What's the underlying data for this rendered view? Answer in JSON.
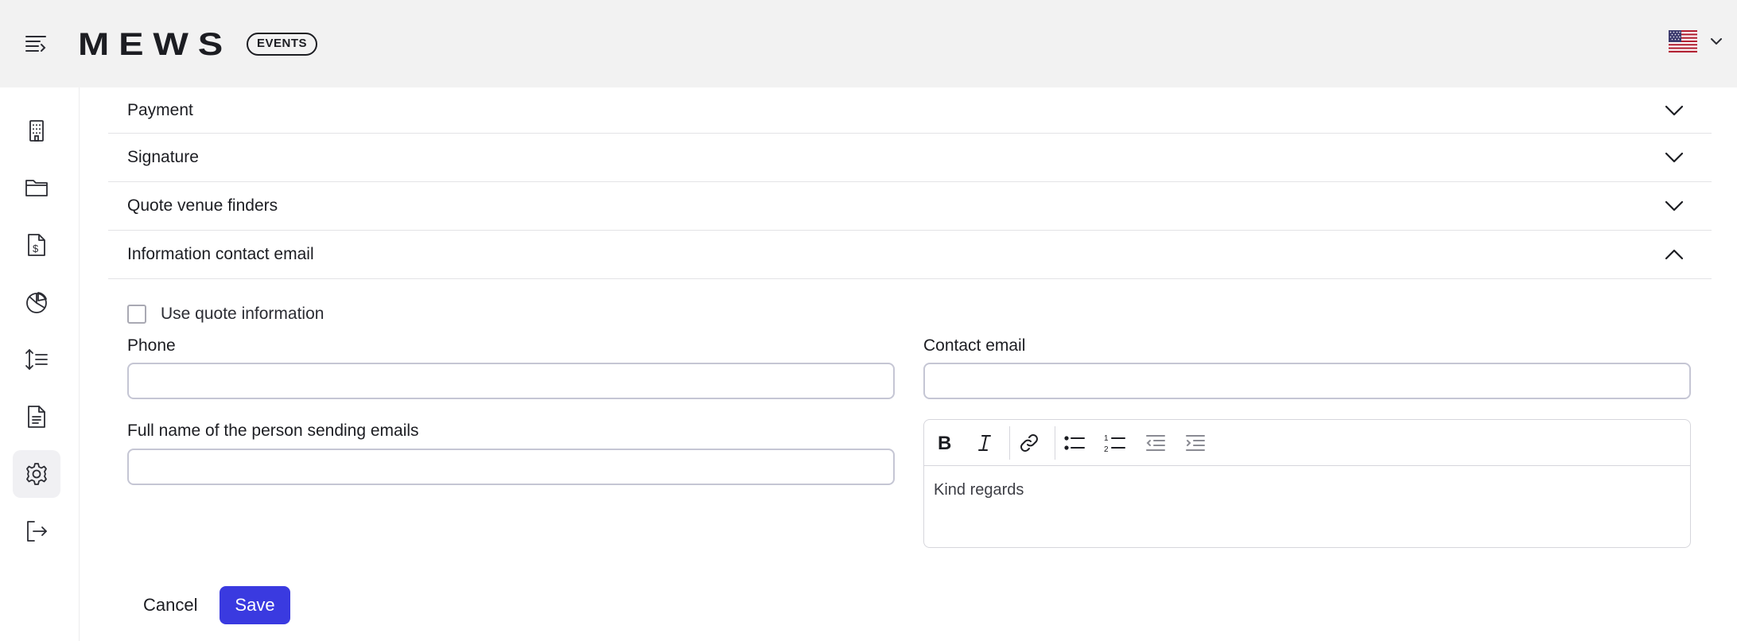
{
  "app": {
    "brand": "MEWS",
    "badge": "EVENTS"
  },
  "header": {
    "menu_icon": "collapse-menu-icon",
    "language": {
      "flag": "us-flag",
      "dropdown_icon": "chevron-down-icon"
    }
  },
  "sidebar": {
    "items": [
      {
        "icon": "building-icon",
        "name": "venues"
      },
      {
        "icon": "folder-icon",
        "name": "files"
      },
      {
        "icon": "invoice-dollar-icon",
        "name": "finance"
      },
      {
        "icon": "pie-chart-icon",
        "name": "reports"
      },
      {
        "icon": "sort-list-icon",
        "name": "sorting"
      },
      {
        "icon": "document-icon",
        "name": "documents"
      },
      {
        "icon": "gear-icon",
        "name": "settings",
        "active": true
      },
      {
        "icon": "logout-icon",
        "name": "logout"
      }
    ]
  },
  "accordion": {
    "sections": [
      {
        "label": "Payment",
        "expanded": false
      },
      {
        "label": "Signature",
        "expanded": false
      },
      {
        "label": "Quote venue finders",
        "expanded": false
      },
      {
        "label": "Information contact email",
        "expanded": true
      }
    ]
  },
  "form": {
    "use_quote_info_label": "Use quote information",
    "use_quote_info_checked": false,
    "phone_label": "Phone",
    "phone_value": "",
    "contact_email_label": "Contact email",
    "contact_email_value": "",
    "full_name_label": "Full name of the person sending emails",
    "full_name_value": "",
    "editor_toolbar": [
      "bold-icon",
      "italic-icon",
      "link-icon",
      "bullet-list-icon",
      "numbered-list-icon",
      "outdent-icon",
      "indent-icon"
    ],
    "editor_text": "Kind regards"
  },
  "actions": {
    "cancel_label": "Cancel",
    "save_label": "Save"
  },
  "colors": {
    "accent": "#3a3ae0",
    "header_bg": "#f2f2f2",
    "text": "#1c1d22"
  }
}
